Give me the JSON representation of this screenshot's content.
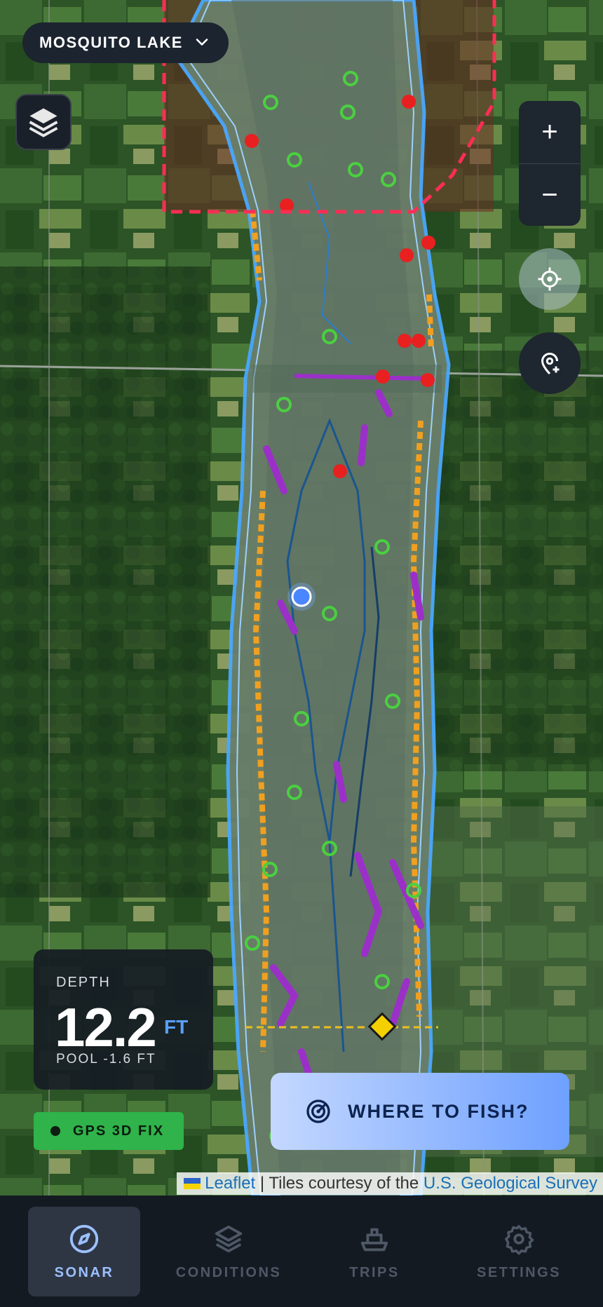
{
  "lake_selector": {
    "name": "MOSQUITO LAKE",
    "icon": "chevron-down-icon"
  },
  "map_controls": {
    "layers_icon": "layers-icon",
    "zoom_in": "+",
    "zoom_out": "−",
    "locate_icon": "crosshair-icon",
    "add_pin_icon": "map-pin-plus-icon"
  },
  "depth_panel": {
    "label": "DEPTH",
    "value": "12.2",
    "unit": "FT",
    "sub": "POOL -1.6 FT"
  },
  "gps_status": {
    "label": "GPS 3D FIX",
    "color": "#2fb34a"
  },
  "where_to_fish": {
    "label": "WHERE TO FISH?",
    "icon": "radar-icon"
  },
  "attribution": {
    "leaflet": "Leaflet",
    "separator": " | Tiles courtesy of the ",
    "usgs": "U.S. Geological Survey"
  },
  "bottom_nav": {
    "items": [
      {
        "label": "SONAR",
        "icon": "compass-icon",
        "active": true
      },
      {
        "label": "CONDITIONS",
        "icon": "layers-icon",
        "active": false
      },
      {
        "label": "TRIPS",
        "icon": "boat-icon",
        "active": false
      },
      {
        "label": "SETTINGS",
        "icon": "gear-icon",
        "active": false
      }
    ]
  },
  "colors": {
    "accent": "#5aa0ff",
    "restricted_zone": "#ff2d55",
    "gps_ok": "#2fb34a",
    "structure": "#9b30c8",
    "weeds": "#f0a020",
    "contour": "#4aa8ff"
  }
}
